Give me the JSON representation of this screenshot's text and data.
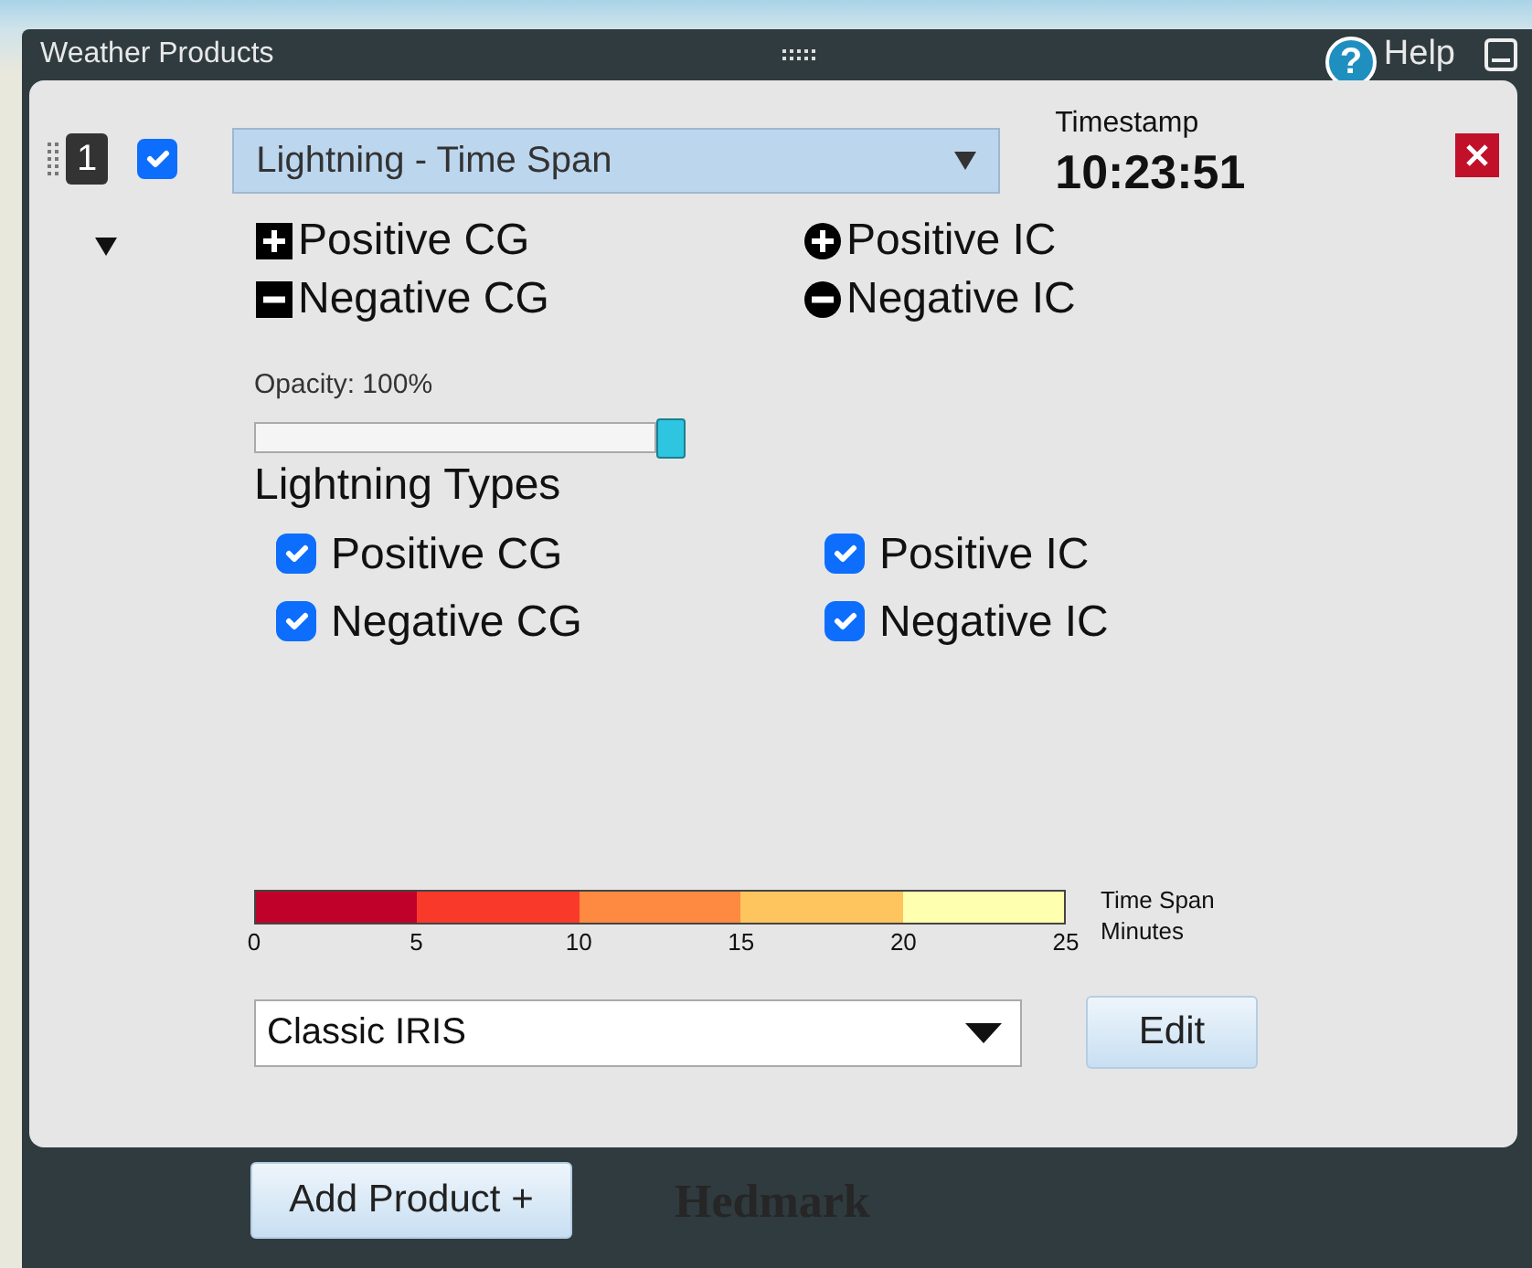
{
  "window": {
    "title": "Weather Products",
    "help_icon": "?",
    "help_label": "Help"
  },
  "product": {
    "number": "1",
    "enabled": true,
    "selected_product": "Lightning - Time Span",
    "timestamp_label": "Timestamp",
    "timestamp": "10:23:51",
    "expanded": true
  },
  "legend": [
    {
      "kind": "squareplus",
      "label": "Positive CG"
    },
    {
      "kind": "circleplus",
      "label": "Positive IC"
    },
    {
      "kind": "squareminus",
      "label": "Negative CG"
    },
    {
      "kind": "circleminus",
      "label": "Negative IC"
    }
  ],
  "opacity": {
    "label": "Opacity: 100%",
    "level": 1.0
  },
  "lightning_types": {
    "title": "Lightning Types",
    "items": [
      {
        "label": "Positive CG",
        "checked": true
      },
      {
        "label": "Positive IC",
        "checked": true
      },
      {
        "label": "Negative CG",
        "checked": true
      },
      {
        "label": "Negative IC",
        "checked": true
      }
    ]
  },
  "color_scale": {
    "segments": [
      {
        "color": "#c0022a"
      },
      {
        "color": "#f93a2a"
      },
      {
        "color": "#fd8a40"
      },
      {
        "color": "#fec45e"
      },
      {
        "color": "#ffffb0"
      }
    ],
    "ticks": [
      "0",
      "5",
      "10",
      "15",
      "20",
      "25"
    ],
    "caption_line_1": "Time Span",
    "caption_line_2": "Minutes"
  },
  "color_table": {
    "value": "Classic IRIS",
    "edit_label": "Edit"
  },
  "add_product_label": "Add Product +",
  "map_labels": [
    "Hedmark"
  ]
}
